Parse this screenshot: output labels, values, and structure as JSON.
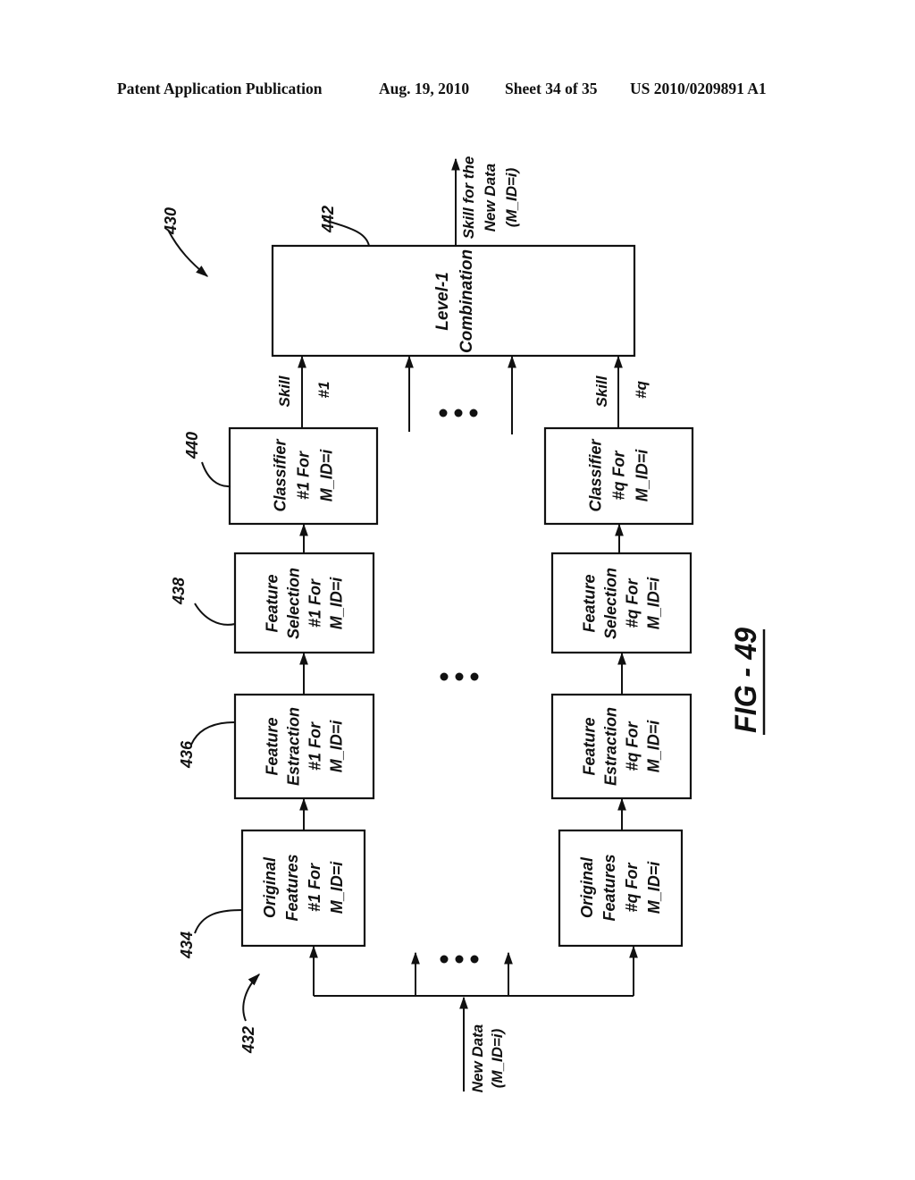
{
  "header": {
    "publication": "Patent Application Publication",
    "date": "Aug. 19, 2010",
    "sheet": "Sheet 34 of 35",
    "patent_number": "US 2010/0209891 A1"
  },
  "figure": {
    "label": "FIG - 49",
    "reference_numbers": {
      "system": "430",
      "input_bus": "432",
      "original_features": "434",
      "feature_extraction": "436",
      "feature_selection": "438",
      "classifier": "440",
      "combination": "442"
    },
    "combination_box": {
      "lines": [
        "Level-1",
        "Combination"
      ]
    },
    "output_label": {
      "lines": [
        "Skill for the",
        "New Data",
        "(M_ID=i)"
      ]
    },
    "input_label": {
      "lines": [
        "New Data",
        "(M_ID=i)"
      ]
    },
    "branches": [
      {
        "id": "1",
        "classifier": [
          "Classifier",
          "#1 For",
          "M_ID=i"
        ],
        "feature_selection": [
          "Feature",
          "Selection",
          "#1 For",
          "M_ID=i"
        ],
        "feature_extraction": [
          "Feature",
          "Estraction",
          "#1 For",
          "M_ID=i"
        ],
        "original_features": [
          "Original",
          "Features",
          "#1 For",
          "M_ID=i"
        ],
        "skill_label": [
          "Skill",
          "#1"
        ]
      },
      {
        "id": "q",
        "classifier": [
          "Classifier",
          "#q For",
          "M_ID=i"
        ],
        "feature_selection": [
          "Feature",
          "Selection",
          "#q For",
          "M_ID=i"
        ],
        "feature_extraction": [
          "Feature",
          "Estraction",
          "#q For",
          "M_ID=i"
        ],
        "original_features": [
          "Original",
          "Features",
          "#q For",
          "M_ID=i"
        ],
        "skill_label": [
          "Skill",
          "#q"
        ]
      }
    ],
    "ellipsis": "• • •"
  }
}
